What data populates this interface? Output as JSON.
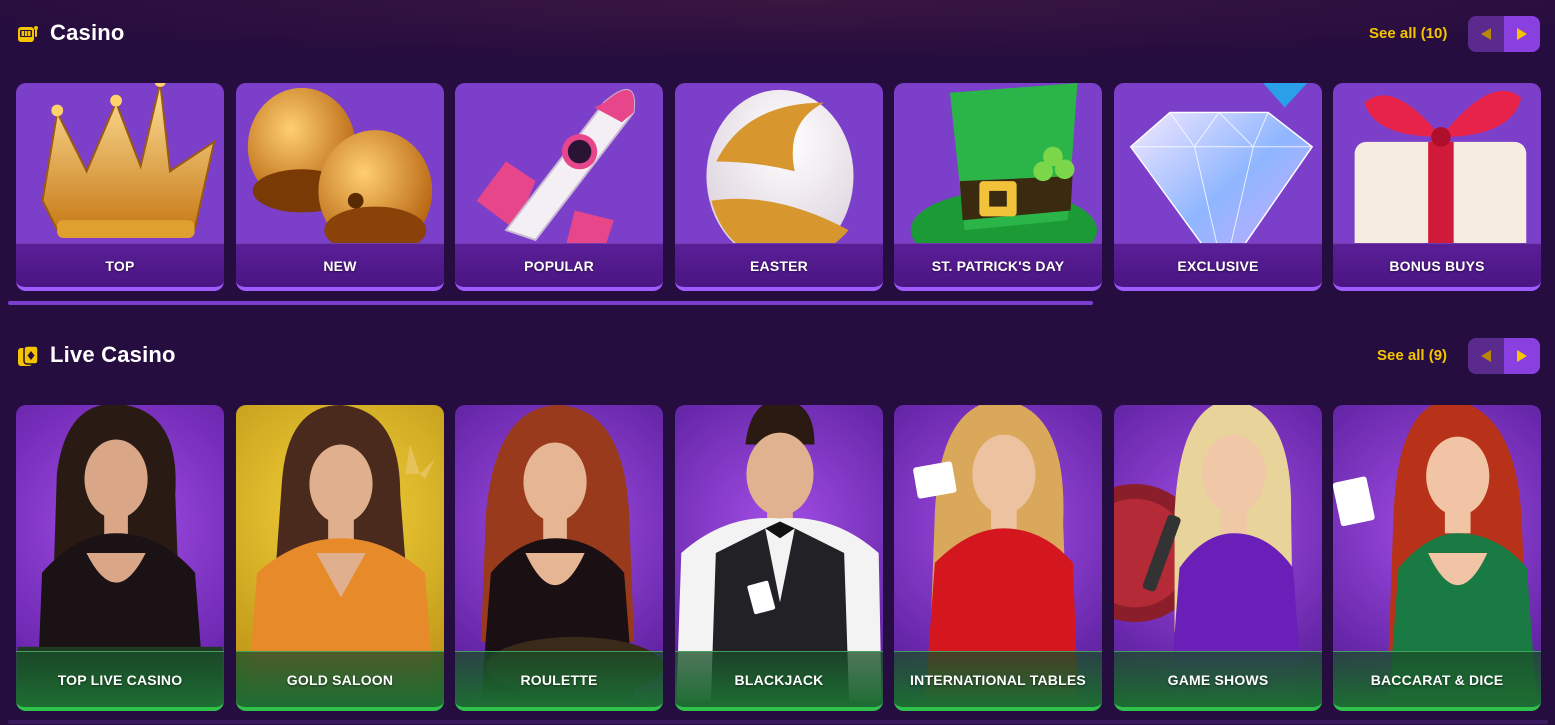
{
  "sections": {
    "casino": {
      "title": "Casino",
      "see_all": "See all (10)",
      "icon": "slot-machine-icon",
      "tiles": [
        {
          "label": "TOP",
          "icon": "crown-icon"
        },
        {
          "label": "NEW",
          "icon": "bells-icon"
        },
        {
          "label": "POPULAR",
          "icon": "rocket-icon"
        },
        {
          "label": "EASTER",
          "icon": "easter-egg-icon"
        },
        {
          "label": "ST. PATRICK'S DAY",
          "icon": "leprechaun-hat-icon"
        },
        {
          "label": "EXCLUSIVE",
          "icon": "diamond-icon"
        },
        {
          "label": "BONUS BUYS",
          "icon": "gift-icon"
        }
      ]
    },
    "live": {
      "title": "Live Casino",
      "see_all": "See all (9)",
      "icon": "cards-icon",
      "tiles": [
        {
          "label": "TOP LIVE CASINO",
          "icon": "dealer-portrait"
        },
        {
          "label": "GOLD SALOON",
          "icon": "dealer-portrait"
        },
        {
          "label": "ROULETTE",
          "icon": "dealer-portrait"
        },
        {
          "label": "BLACKJACK",
          "icon": "dealer-portrait"
        },
        {
          "label": "INTERNATIONAL TABLES",
          "icon": "dealer-portrait"
        },
        {
          "label": "GAME SHOWS",
          "icon": "dealer-portrait"
        },
        {
          "label": "BACCARAT & DICE",
          "icon": "dealer-portrait"
        }
      ]
    }
  },
  "colors": {
    "background": "#260d3f",
    "accent_yellow": "#f5c400",
    "tile_purple": "#7c3fc9",
    "label_bar_purple": "#4a1583",
    "label_bar_green": "#1d6e33",
    "live_border_green": "#2ec24a"
  }
}
